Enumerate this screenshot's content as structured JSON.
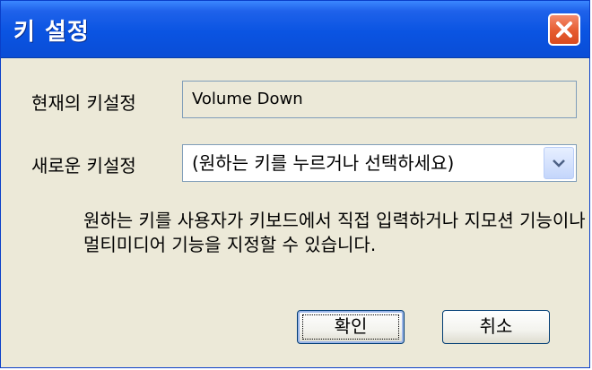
{
  "dialog": {
    "title": "키 설정"
  },
  "form": {
    "current_label": "현재의 키설정",
    "current_value": "Volume Down",
    "new_label": "새로운 키설정",
    "new_selected": "(원하는 키를 누르거나 선택하세요)"
  },
  "help": {
    "text": "원하는 키를 사용자가 키보드에서 직접 입력하거나 지모션 기능이나 멀티미디어 기능을 지정할 수 있습니다."
  },
  "buttons": {
    "ok": "확인",
    "cancel": "취소"
  },
  "colors": {
    "titlebar": "#0a54e2",
    "close": "#e65c2f",
    "window_bg": "#ece9d8"
  }
}
